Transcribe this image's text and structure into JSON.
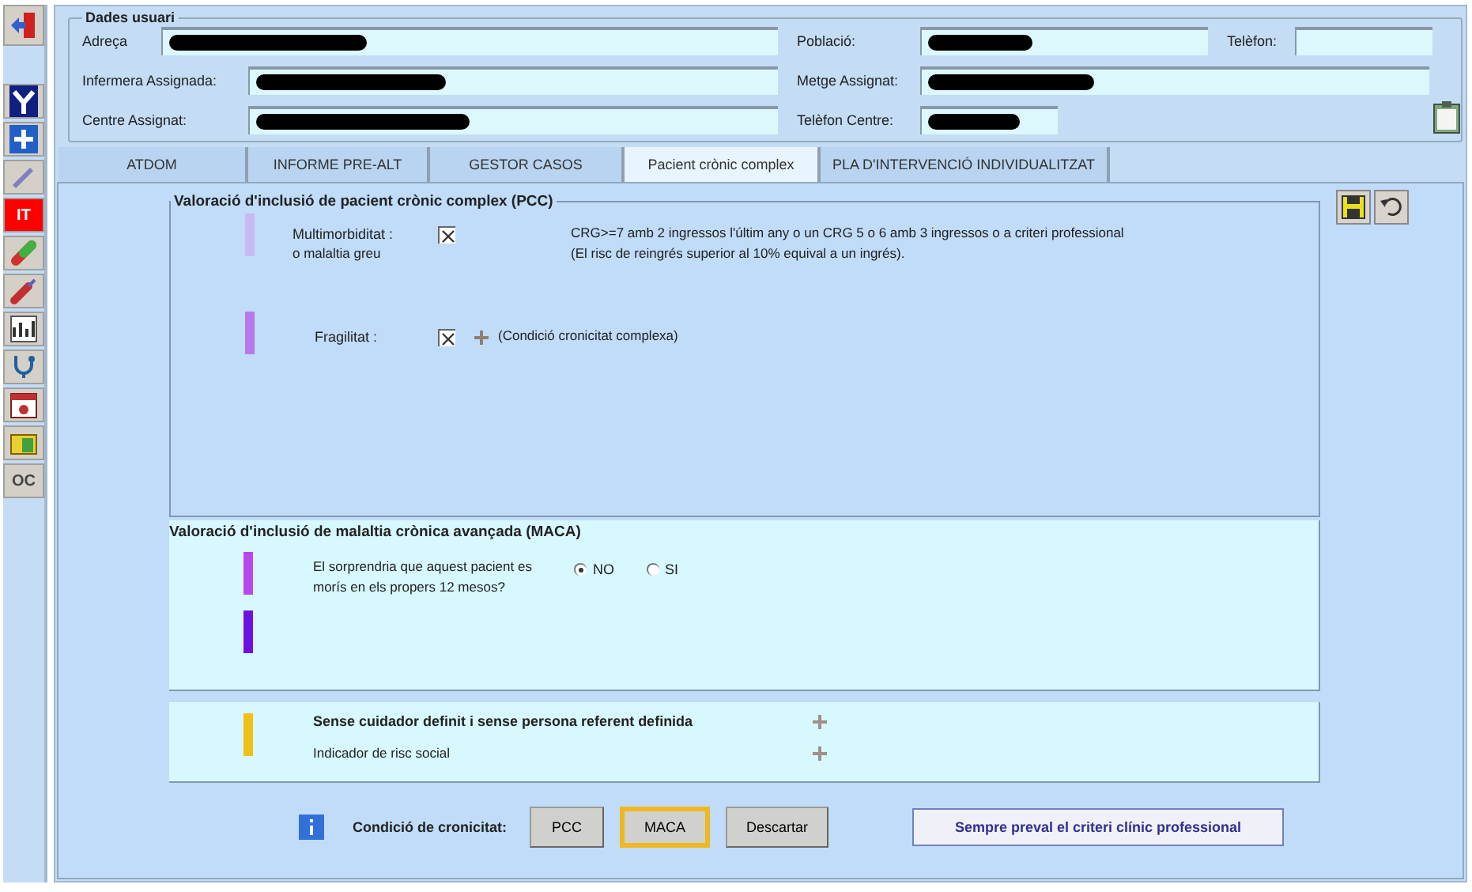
{
  "sidebar": [
    {
      "kind": "exit"
    },
    {
      "kind": "gamma"
    },
    {
      "kind": "plus"
    },
    {
      "kind": "pen"
    },
    {
      "kind": "label",
      "label": "IT"
    },
    {
      "kind": "pill"
    },
    {
      "kind": "syringe"
    },
    {
      "kind": "chart"
    },
    {
      "kind": "stethoscope"
    },
    {
      "kind": "calendar"
    },
    {
      "kind": "folder"
    },
    {
      "kind": "label",
      "label": "OC"
    }
  ],
  "user_data": {
    "title": "Dades usuari",
    "rows": [
      [
        {
          "label": "Adreça",
          "redacted": true
        },
        {
          "label": "Població:",
          "redacted": true
        },
        {
          "label": "Telèfon:"
        }
      ],
      [
        {
          "label": "Infermera Assignada:",
          "redacted": true
        },
        {
          "label": "Metge Assignat:",
          "redacted": true
        }
      ],
      [
        {
          "label": "Centre Assignat:",
          "redacted": true
        },
        {
          "label": "Telèfon Centre:",
          "redacted": true
        }
      ]
    ]
  },
  "tabs": [
    {
      "label": "ATDOM",
      "selected": false
    },
    {
      "label": "INFORME PRE-ALT",
      "selected": false
    },
    {
      "label": "GESTOR CASOS",
      "selected": false
    },
    {
      "label": "Pacient crònic complex",
      "selected": true
    },
    {
      "label": "PLA D'INTERVENCIÓ INDIVIDUALITZAT",
      "selected": false
    }
  ],
  "pcc": {
    "title": "Valoració d'inclusió de pacient crònic complex (PCC)",
    "items": [
      {
        "color": "#c8b8f4",
        "label": "Multimorbiditat :",
        "sublabel": "o malaltia greu",
        "checked": true,
        "plus": false,
        "description": [
          "CRG>=7 amb 2 ingressos l'últim any  o un CRG 5 o 6 amb 3 ingressos  o a criteri professional",
          "(El risc de reingrés superior al 10% equival a un ingrés)."
        ]
      },
      {
        "color": "#b878ec",
        "label": "Fragilitat :",
        "checked": true,
        "plus": true,
        "description": [
          "(Condició cronicitat complexa)"
        ]
      }
    ]
  },
  "maca": {
    "title": "Valoració d'inclusió de malaltia crònica avançada (MACA)",
    "question": "El sorprendria que aquest pacient es morís en els propers 12 mesos?",
    "bars": [
      {
        "color": "#b848ec"
      },
      {
        "color": "#7010e0"
      }
    ],
    "options": [
      {
        "label": "NO",
        "selected": true
      },
      {
        "label": "SI",
        "selected": false
      }
    ]
  },
  "social": {
    "color": "#f0c018",
    "items": [
      {
        "label": "Sense cuidador definit i sense persona referent definida",
        "bold": true
      },
      {
        "label": "Indicador de risc social",
        "bold": false
      }
    ]
  },
  "footer": {
    "label": "Condició de cronicitat:",
    "buttons": [
      {
        "label": "PCC",
        "selected": false
      },
      {
        "label": "MACA",
        "selected": true
      },
      {
        "label": "Descartar",
        "selected": false
      }
    ],
    "note": "Sempre preval el criteri clínic professional"
  }
}
